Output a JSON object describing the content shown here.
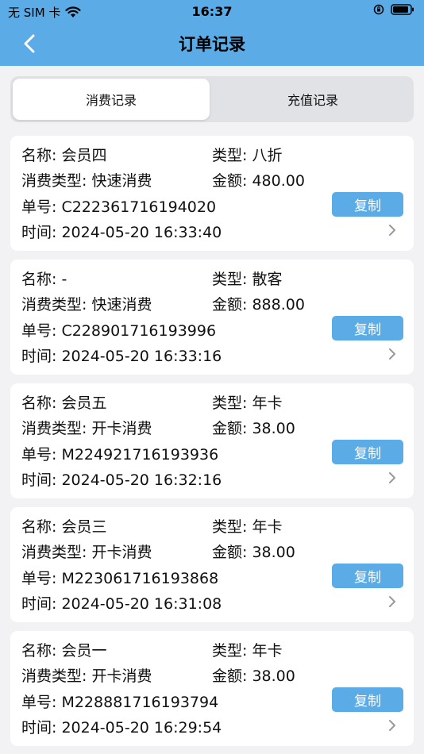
{
  "status_bar": {
    "carrier": "无 SIM 卡",
    "time": "16:37"
  },
  "nav": {
    "title": "订单记录",
    "back_icon": "chevron-left-icon"
  },
  "tabs": [
    {
      "label": "消费记录",
      "active": true
    },
    {
      "label": "充值记录",
      "active": false
    }
  ],
  "labels": {
    "name": "名称:",
    "type": "类型:",
    "consume_type": "消费类型:",
    "amount": "金额:",
    "order_no": "单号:",
    "time": "时间:",
    "copy": "复制"
  },
  "records": [
    {
      "name": "会员四",
      "type": "八折",
      "consume_type": "快速消费",
      "amount": "480.00",
      "order_no": "C222361716194020",
      "time": "2024-05-20 16:33:40"
    },
    {
      "name": "-",
      "type": "散客",
      "consume_type": "快速消费",
      "amount": "888.00",
      "order_no": "C228901716193996",
      "time": "2024-05-20 16:33:16"
    },
    {
      "name": "会员五",
      "type": "年卡",
      "consume_type": "开卡消费",
      "amount": "38.00",
      "order_no": "M224921716193936",
      "time": "2024-05-20 16:32:16"
    },
    {
      "name": "会员三",
      "type": "年卡",
      "consume_type": "开卡消费",
      "amount": "38.00",
      "order_no": "M223061716193868",
      "time": "2024-05-20 16:31:08"
    },
    {
      "name": "会员一",
      "type": "年卡",
      "consume_type": "开卡消费",
      "amount": "38.00",
      "order_no": "M228881716193794",
      "time": "2024-05-20 16:29:54"
    }
  ],
  "colors": {
    "header": "#5aabe6",
    "button": "#5aabe6",
    "background": "#f2f2f4"
  }
}
